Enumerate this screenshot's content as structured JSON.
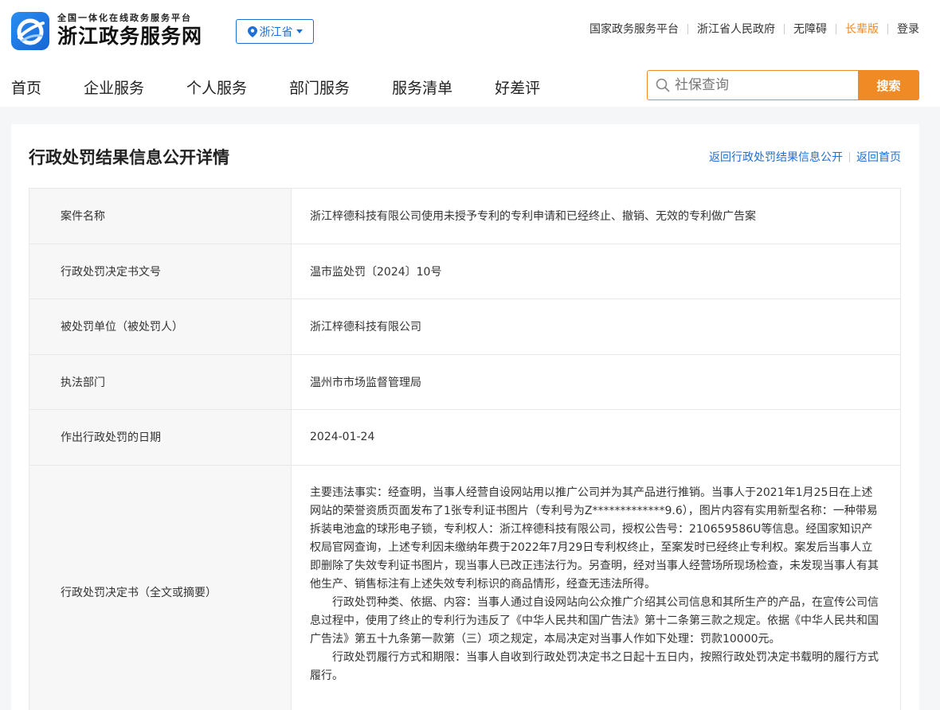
{
  "header": {
    "logo_subtitle": "全国一体化在线政务服务平台",
    "logo_title": "浙江政务服务网",
    "region": "浙江省",
    "top_links": [
      "国家政务服务平台",
      "浙江省人民政府",
      "无障碍",
      "长辈版",
      "登录"
    ]
  },
  "nav": {
    "items": [
      "首页",
      "企业服务",
      "个人服务",
      "部门服务",
      "服务清单",
      "好差评"
    ]
  },
  "search": {
    "placeholder": "社保查询",
    "button": "搜索"
  },
  "page": {
    "title": "行政处罚结果信息公开详情",
    "link_back_list": "返回行政处罚结果信息公开",
    "link_home": "返回首页"
  },
  "details": [
    {
      "label": "案件名称",
      "value": "浙江梓德科技有限公司使用未授予专利的专利申请和已经终止、撤销、无效的专利做广告案"
    },
    {
      "label": "行政处罚决定书文号",
      "value": "温市监处罚〔2024〕10号"
    },
    {
      "label": "被处罚单位（被处罚人）",
      "value": "浙江梓德科技有限公司"
    },
    {
      "label": "执法部门",
      "value": "温州市市场监督管理局"
    },
    {
      "label": "作出行政处罚的日期",
      "value": "2024-01-24"
    }
  ],
  "decision": {
    "label": "行政处罚决定书（全文或摘要）",
    "paragraphs": [
      "主要违法事实：经查明，当事人经营自设网站用以推广公司并为其产品进行推销。当事人于2021年1月25日在上述网站的荣誉资质页面发布了1张专利证书图片（专利号为Z*************9.6），图片内容有实用新型名称：一种带易拆装电池盒的球形电子锁，专利权人：浙江梓德科技有限公司，授权公告号：210659586U等信息。经国家知识产权局官网查询，上述专利因未缴纳年费于2022年7月29日专利权终止，至案发时已经终止专利权。案发后当事人立即删除了失效专利证书图片，现当事人已改正违法行为。另查明，经对当事人经营场所现场检查，未发现当事人有其他生产、销售标注有上述失效专利标识的商品情形，经查无违法所得。",
      "行政处罚种类、依据、内容：当事人通过自设网站向公众推广介绍其公司信息和其所生产的产品，在宣传公司信息过程中，使用了终止的专利行为违反了《中华人民共和国广告法》第十二条第三款之规定。依据《中华人民共和国广告法》第五十九条第一款第（三）项之规定，本局决定对当事人作如下处理：罚款10000元。",
      "行政处罚履行方式和期限：当事人自收到行政处罚决定书之日起十五日内，按照行政处罚决定书载明的履行方式履行。"
    ]
  }
}
